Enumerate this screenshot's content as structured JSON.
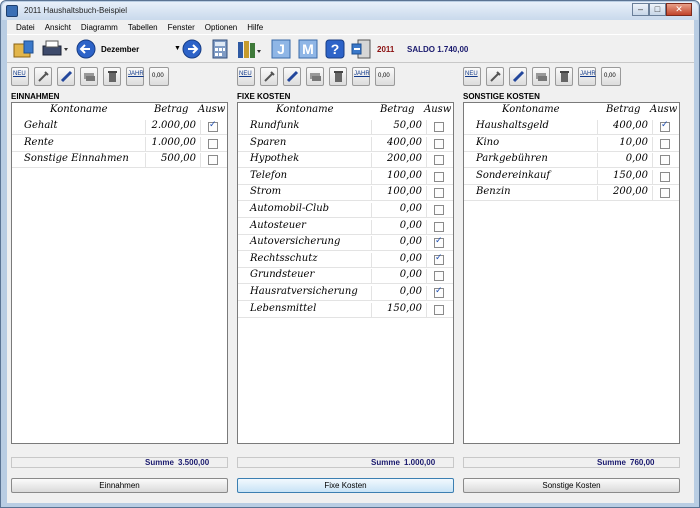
{
  "window": {
    "title": "2011 Haushaltsbuch-Beispiel"
  },
  "menu": [
    "Datei",
    "Ansicht",
    "Diagramm",
    "Tabellen",
    "Fenster",
    "Optionen",
    "Hilfe"
  ],
  "toolbar": {
    "month": "Dezember",
    "year": "2011",
    "saldo": "SALDO  1.740,00"
  },
  "panel_tools": {
    "new": "NEU",
    "year": "JAHR",
    "zero": "0,00"
  },
  "columns": {
    "name": "Kontoname",
    "amount": "Betrag",
    "select": "Ausw"
  },
  "panels": [
    {
      "heading": "EINNAHMEN",
      "rows": [
        {
          "name": "Gehalt",
          "amount": "2.000,00",
          "checked": true
        },
        {
          "name": "Rente",
          "amount": "1.000,00",
          "checked": false
        },
        {
          "name": "Sonstige Einnahmen",
          "amount": "500,00",
          "checked": false
        }
      ],
      "sum_label": "Summe",
      "sum": "3.500,00",
      "button": "Einnahmen",
      "active": false
    },
    {
      "heading": "FIXE KOSTEN",
      "rows": [
        {
          "name": "Rundfunk",
          "amount": "50,00",
          "checked": false
        },
        {
          "name": "Sparen",
          "amount": "400,00",
          "checked": false
        },
        {
          "name": "Hypothek",
          "amount": "200,00",
          "checked": false
        },
        {
          "name": "Telefon",
          "amount": "100,00",
          "checked": false
        },
        {
          "name": "Strom",
          "amount": "100,00",
          "checked": false
        },
        {
          "name": "Automobil-Club",
          "amount": "0,00",
          "checked": false
        },
        {
          "name": "Autosteuer",
          "amount": "0,00",
          "checked": false
        },
        {
          "name": "Autoversicherung",
          "amount": "0,00",
          "checked": true
        },
        {
          "name": "Rechtsschutz",
          "amount": "0,00",
          "checked": true
        },
        {
          "name": "Grundsteuer",
          "amount": "0,00",
          "checked": false
        },
        {
          "name": "Hausratversicherung",
          "amount": "0,00",
          "checked": true
        },
        {
          "name": "Lebensmittel",
          "amount": "150,00",
          "checked": false
        }
      ],
      "sum_label": "Summe",
      "sum": "1.000,00",
      "button": "Fixe Kosten",
      "active": true
    },
    {
      "heading": "SONSTIGE KOSTEN",
      "rows": [
        {
          "name": "Haushaltsgeld",
          "amount": "400,00",
          "checked": true
        },
        {
          "name": "Kino",
          "amount": "10,00",
          "checked": false
        },
        {
          "name": "Parkgebühren",
          "amount": "0,00",
          "checked": false
        },
        {
          "name": "Sondereinkauf",
          "amount": "150,00",
          "checked": false
        },
        {
          "name": "Benzin",
          "amount": "200,00",
          "checked": false
        }
      ],
      "sum_label": "Summe",
      "sum": "760,00",
      "button": "Sonstige Kosten",
      "active": false
    }
  ]
}
